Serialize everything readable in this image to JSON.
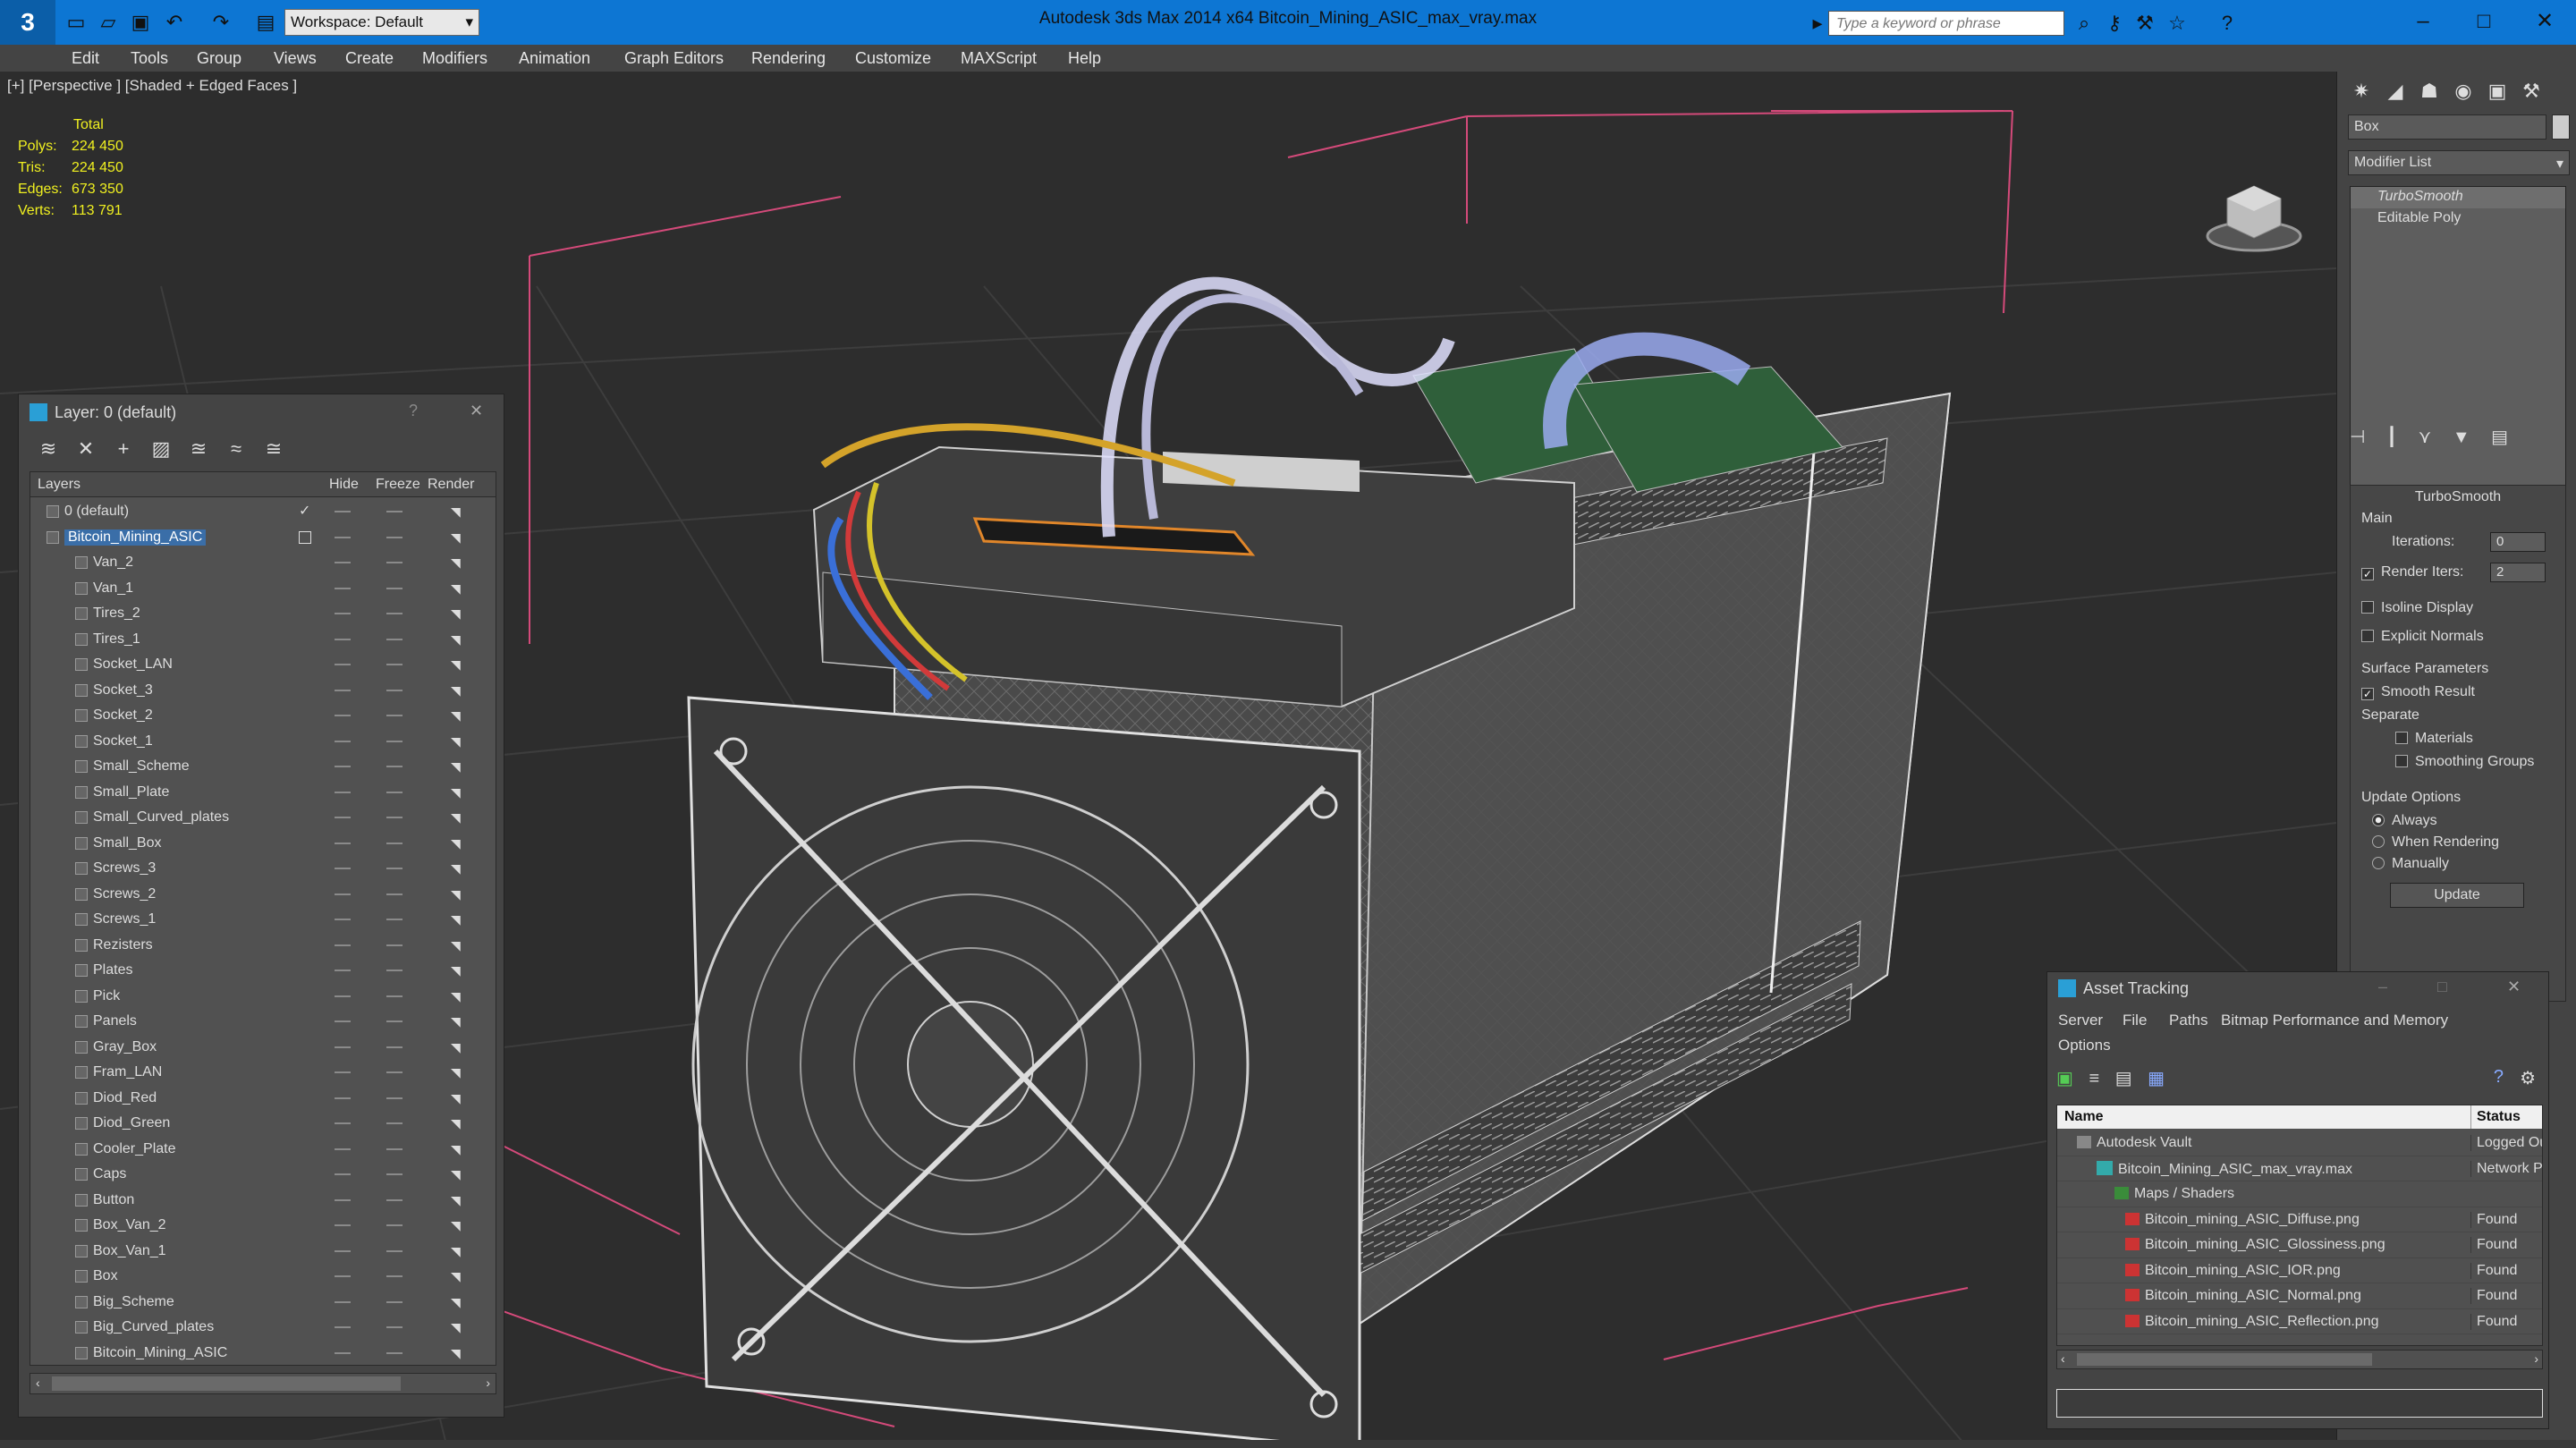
{
  "titlebar": {
    "title": "Autodesk 3ds Max  2014 x64      Bitcoin_Mining_ASIC_max_vray.max",
    "workspace": "Workspace: Default",
    "search_placeholder": "Type a keyword or phrase"
  },
  "menu": [
    "Edit",
    "Tools",
    "Group",
    "Views",
    "Create",
    "Modifiers",
    "Animation",
    "Graph Editors",
    "Rendering",
    "Customize",
    "MAXScript",
    "Help"
  ],
  "viewport": {
    "label": "[+] [Perspective ] [Shaded + Edged Faces ]",
    "stats": {
      "header": "Total",
      "rows": [
        {
          "k": "Polys:",
          "v": "224 450"
        },
        {
          "k": "Tris:",
          "v": "224 450"
        },
        {
          "k": "Edges:",
          "v": "673 350"
        },
        {
          "k": "Verts:",
          "v": "113 791"
        }
      ]
    }
  },
  "command_panel": {
    "object_name": "Box",
    "modifier_list": "Modifier List",
    "stack": [
      "TurboSmooth",
      "Editable Poly"
    ],
    "rollout_title": "TurboSmooth",
    "main_label": "Main",
    "iterations_label": "Iterations:",
    "iterations_value": "0",
    "render_iters_label": "Render Iters:",
    "render_iters_value": "2",
    "isoline": "Isoline Display",
    "explicit_normals": "Explicit Normals",
    "surface_params": "Surface Parameters",
    "smooth_result": "Smooth Result",
    "separate": "Separate",
    "materials": "Materials",
    "smoothing_groups": "Smoothing Groups",
    "update_options": "Update Options",
    "always": "Always",
    "when_rendering": "When Rendering",
    "manually": "Manually",
    "update_button": "Update"
  },
  "layer_panel": {
    "title": "Layer: 0 (default)",
    "col_layers": "Layers",
    "col_hide": "Hide",
    "col_freeze": "Freeze",
    "col_render": "Render",
    "layers": [
      "0 (default)",
      "Bitcoin_Mining_ASIC",
      "Van_2",
      "Van_1",
      "Tires_2",
      "Tires_1",
      "Socket_LAN",
      "Socket_3",
      "Socket_2",
      "Socket_1",
      "Small_Scheme",
      "Small_Plate",
      "Small_Curved_plates",
      "Small_Box",
      "Screws_3",
      "Screws_2",
      "Screws_1",
      "Rezisters",
      "Plates",
      "Pick",
      "Panels",
      "Gray_Box",
      "Fram_LAN",
      "Diod_Red",
      "Diod_Green",
      "Cooler_Plate",
      "Caps",
      "Button",
      "Box_Van_2",
      "Box_Van_1",
      "Box",
      "Big_Scheme",
      "Big_Curved_plates",
      "Bitcoin_Mining_ASIC"
    ]
  },
  "asset_panel": {
    "title": "Asset Tracking",
    "menu": [
      "Server",
      "File",
      "Paths",
      "Bitmap Performance and Memory",
      "Options"
    ],
    "col_name": "Name",
    "col_status": "Status",
    "rows": [
      {
        "name": "Autodesk Vault",
        "status": "Logged Out"
      },
      {
        "name": "Bitcoin_Mining_ASIC_max_vray.max",
        "status": "Network Path"
      },
      {
        "name": "Maps / Shaders",
        "status": ""
      },
      {
        "name": "Bitcoin_mining_ASIC_Diffuse.png",
        "status": "Found"
      },
      {
        "name": "Bitcoin_mining_ASIC_Glossiness.png",
        "status": "Found"
      },
      {
        "name": "Bitcoin_mining_ASIC_IOR.png",
        "status": "Found"
      },
      {
        "name": "Bitcoin_mining_ASIC_Normal.png",
        "status": "Found"
      },
      {
        "name": "Bitcoin_mining_ASIC_Reflection.png",
        "status": "Found"
      }
    ]
  }
}
